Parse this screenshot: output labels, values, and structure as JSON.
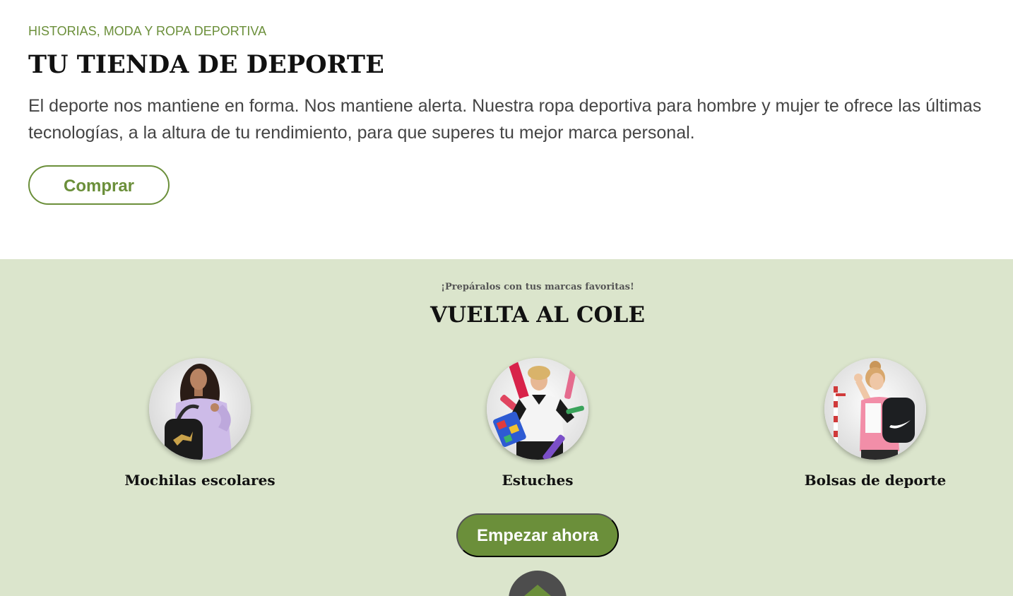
{
  "hero": {
    "eyebrow": "HISTORIAS, MODA Y ROPA DEPORTIVA",
    "title": "TU TIENDA DE DEPORTE",
    "description": "El deporte nos mantiene en forma. Nos mantiene alerta. Nuestra ropa deportiva para hombre y mujer te ofrece las últimas tecnologías, a la altura de tu rendimiento, para que superes tu mejor marca personal.",
    "cta_label": "Comprar"
  },
  "back_to_school": {
    "kicker": "¡Prepáralos con tus marcas favoritas!",
    "title": "VUELTA AL COLE",
    "categories": [
      {
        "label": "Mochilas escolares",
        "icon": "girl-with-backpack-photo"
      },
      {
        "label": "Estuches",
        "icon": "boy-with-pencil-case-photo"
      },
      {
        "label": "Bolsas de deporte",
        "icon": "woman-with-sports-backpack-photo"
      }
    ],
    "cta_label": "Empezar ahora"
  },
  "scroll_top": {
    "icon": "arrow-up-icon"
  },
  "colors": {
    "accent": "#6b8f3a",
    "section_bg": "#dbe5cc",
    "text_dark": "#111111",
    "text_body": "#444444",
    "scroll_button": "#4d4d4d"
  }
}
